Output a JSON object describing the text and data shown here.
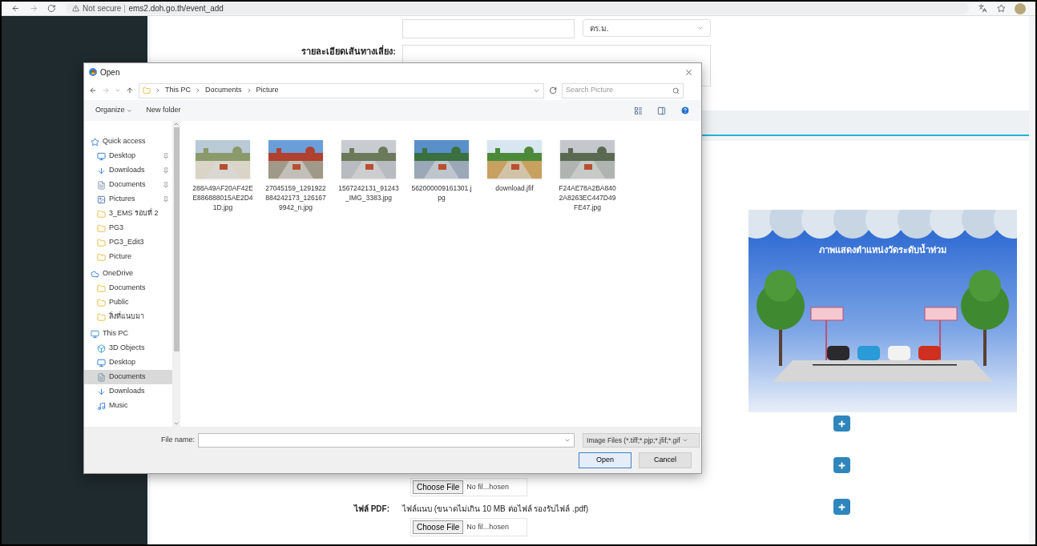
{
  "browser": {
    "security": "Not secure",
    "url": "ems2.doh.go.th/event_add"
  },
  "form_top": {
    "unit_select": "ตร.ม.",
    "detour_label": "รายละเอียดเส้นทางเลี่ยง:"
  },
  "dialog": {
    "title": "Open",
    "breadcrumb": [
      "This PC",
      "Documents",
      "Picture"
    ],
    "search_placeholder": "Search Picture",
    "organize": "Organize",
    "new_folder": "New folder",
    "nav": [
      {
        "label": "Quick access",
        "kind": "star",
        "selected": false,
        "children": [
          {
            "label": "Desktop",
            "kind": "desktop",
            "pinned": true,
            "selected": false
          },
          {
            "label": "Downloads",
            "kind": "download",
            "pinned": true,
            "selected": false
          },
          {
            "label": "Documents",
            "kind": "document",
            "pinned": true,
            "selected": false
          },
          {
            "label": "Pictures",
            "kind": "pictures",
            "pinned": true,
            "selected": false
          },
          {
            "label": "3_EMS รอบที่ 2",
            "kind": "folder",
            "pinned": false,
            "selected": false
          },
          {
            "label": "PG3",
            "kind": "folder",
            "pinned": false,
            "selected": false
          },
          {
            "label": "PG3_Edit3",
            "kind": "folder",
            "pinned": false,
            "selected": false
          },
          {
            "label": "Picture",
            "kind": "folder",
            "pinned": false,
            "selected": false
          }
        ]
      },
      {
        "label": "OneDrive",
        "kind": "cloud",
        "selected": false,
        "children": [
          {
            "label": "Documents",
            "kind": "folder",
            "pinned": false,
            "selected": false
          },
          {
            "label": "Public",
            "kind": "folder",
            "pinned": false,
            "selected": false
          },
          {
            "label": "สิ่งที่แนบมา",
            "kind": "folder",
            "pinned": false,
            "selected": false
          }
        ]
      },
      {
        "label": "This PC",
        "kind": "pc",
        "selected": false,
        "children": [
          {
            "label": "3D Objects",
            "kind": "objects",
            "pinned": false,
            "selected": false
          },
          {
            "label": "Desktop",
            "kind": "desktop",
            "pinned": false,
            "selected": false
          },
          {
            "label": "Documents",
            "kind": "document",
            "pinned": false,
            "selected": true
          },
          {
            "label": "Downloads",
            "kind": "download",
            "pinned": false,
            "selected": false
          },
          {
            "label": "Music",
            "kind": "music",
            "pinned": false,
            "selected": false
          }
        ]
      }
    ],
    "files": [
      {
        "name": "288A49AF20AF42EE886888015AE2D41D.jpg",
        "kind": "picture"
      },
      {
        "name": "27045159_1291922884242173_1261679942_n.jpg",
        "kind": "picture"
      },
      {
        "name": "1567242131_91243_IMG_3383.jpg",
        "kind": "picture"
      },
      {
        "name": "562000009161301.jpg",
        "kind": "picture"
      },
      {
        "name": "download.jfif",
        "kind": "picture"
      },
      {
        "name": "F24AE78A2BA8402A8263EC447D49FE47.jpg",
        "kind": "picture"
      }
    ],
    "file_name_label": "File name:",
    "filter": "Image Files (*.tiff;*.pjp;*.jfif;*.gif",
    "open_button": "Open",
    "cancel_button": "Cancel"
  },
  "illustration_title": "ภาพแสดงตำแหน่งวัดระดับน้ำท่วม",
  "add_buttons": [
    {
      "kind": "plus"
    },
    {
      "kind": "plus"
    },
    {
      "kind": "plus"
    }
  ],
  "upload_rows": [
    {
      "kind": "file",
      "button": "Choose File",
      "status": "No fil...hosen"
    },
    {
      "kind": "pdf",
      "label": "ไฟล์ PDF:",
      "hint": "ไฟล์แนบ (ขนาดไม่เกิน 10 MB ต่อไฟล์ รองรับไฟล์ .pdf)",
      "button": "Choose File",
      "status": "No fil...hosen"
    }
  ]
}
